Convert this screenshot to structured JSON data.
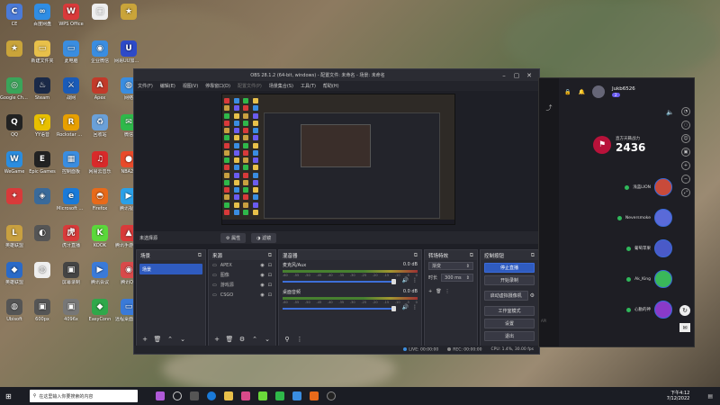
{
  "desktop": {
    "icons": [
      {
        "label": "CE",
        "color": "#4a7ad8",
        "glyph": "C"
      },
      {
        "label": "百度网盘",
        "color": "#2f8de4",
        "glyph": "∞"
      },
      {
        "label": "WPS Office",
        "color": "#d93a3a",
        "glyph": "W"
      },
      {
        "label": "",
        "color": "#eee",
        "glyph": "▢"
      },
      {
        "label": "",
        "color": "#c9a43a",
        "glyph": "★"
      },
      {
        "label": "",
        "color": "#c9a43a",
        "glyph": "★"
      },
      {
        "label": "新建文件夹",
        "color": "#e8c04a",
        "glyph": "▭"
      },
      {
        "label": "此电脑",
        "color": "#3a8de0",
        "glyph": "▭"
      },
      {
        "label": "企业微信",
        "color": "#3a8de0",
        "glyph": "◉"
      },
      {
        "label": "网易UU加速器",
        "color": "#2d4ac8",
        "glyph": "U"
      },
      {
        "label": "Google Chrome",
        "color": "#3aa55a",
        "glyph": "◎"
      },
      {
        "label": "Steam",
        "color": "#1b2a48",
        "glyph": "♨"
      },
      {
        "label": "战网",
        "color": "#1a5bb8",
        "glyph": "⚔"
      },
      {
        "label": "Apex",
        "color": "#c23a2a",
        "glyph": "A"
      },
      {
        "label": "网络",
        "color": "#3a8de0",
        "glyph": "◍"
      },
      {
        "label": "QQ",
        "color": "#222",
        "glyph": "Q"
      },
      {
        "label": "YY语音",
        "color": "#e8c000",
        "glyph": "Y"
      },
      {
        "label": "Rockstar Games",
        "color": "#e8a000",
        "glyph": "R"
      },
      {
        "label": "回收站",
        "color": "#6aa0d8",
        "glyph": "♻"
      },
      {
        "label": "微信",
        "color": "#2fb84a",
        "glyph": "✉"
      },
      {
        "label": "WeGame",
        "color": "#2a8de0",
        "glyph": "W"
      },
      {
        "label": "Epic Games",
        "color": "#222",
        "glyph": "E"
      },
      {
        "label": "控制面板",
        "color": "#3a8de0",
        "glyph": "▦"
      },
      {
        "label": "网易云音乐",
        "color": "#d82a2a",
        "glyph": "♫"
      },
      {
        "label": "NBA2K",
        "color": "#e84a2a",
        "glyph": "●"
      },
      {
        "label": "",
        "color": "#d83a3a",
        "glyph": "✦"
      },
      {
        "label": "",
        "color": "#3a6a9a",
        "glyph": "◈"
      },
      {
        "label": "Microsoft Edge",
        "color": "#1a7ad8",
        "glyph": "e"
      },
      {
        "label": "Firefox",
        "color": "#e86a1a",
        "glyph": "◓"
      },
      {
        "label": "腾讯视频",
        "color": "#2aa0e8",
        "glyph": "▶"
      },
      {
        "label": "英雄联盟",
        "color": "#c8a040",
        "glyph": "L"
      },
      {
        "label": "",
        "color": "#555",
        "glyph": "◐"
      },
      {
        "label": "虎牙直播",
        "color": "#d83a3a",
        "glyph": "虎"
      },
      {
        "label": "KOOK",
        "color": "#5ad83a",
        "glyph": "K"
      },
      {
        "label": "腾讯手游助手",
        "color": "#d83a3a",
        "glyph": "▲"
      },
      {
        "label": "英雄联盟",
        "color": "#2a6ac8",
        "glyph": "◆"
      },
      {
        "label": "",
        "color": "#eee",
        "glyph": "◍"
      },
      {
        "label": "屏幕录制",
        "color": "#444",
        "glyph": "▣"
      },
      {
        "label": "腾讯会议",
        "color": "#3a7ad8",
        "glyph": "▶"
      },
      {
        "label": "腾讯QQ",
        "color": "#d84a4a",
        "glyph": "◉"
      },
      {
        "label": "Ubisoft",
        "color": "#555",
        "glyph": "◍"
      },
      {
        "label": "600px",
        "color": "#555",
        "glyph": "▣"
      },
      {
        "label": "4096x",
        "color": "#777",
        "glyph": "▣"
      },
      {
        "label": "EasyConn",
        "color": "#2fa84a",
        "glyph": "◆"
      },
      {
        "label": "远程桌面连接",
        "color": "#3a7ad8",
        "glyph": "▭"
      }
    ]
  },
  "obs": {
    "title": "OBS 28.1.2 (64-bit, windows) - 配置文件: 未命名 - 场景: 未命名",
    "menu": [
      "文件(F)",
      "编辑(E)",
      "视图(V)",
      "停靠窗口(D)",
      "配置文件(P)",
      "场景集合(S)",
      "工具(T)",
      "帮助(H)"
    ],
    "source_bar": {
      "label": "未选择源",
      "properties": "属性",
      "filters": "滤镜"
    },
    "scenes": {
      "title": "场景",
      "items": [
        "场景"
      ]
    },
    "sources": {
      "title": "来源",
      "items": [
        "APEX",
        "图像",
        "游戏源",
        "CSGO"
      ]
    },
    "mixer": {
      "title": "混音器",
      "channels": [
        {
          "name": "麦克风/Aux",
          "db": "0.0 dB"
        },
        {
          "name": "桌面音频",
          "db": "0.0 dB"
        }
      ],
      "scale": [
        "-60",
        "-55",
        "-50",
        "-45",
        "-40",
        "-35",
        "-30",
        "-25",
        "-20",
        "-15",
        "-10",
        "-5",
        "0"
      ]
    },
    "transitions": {
      "title": "转场特效",
      "type": "渐变",
      "duration_label": "时长",
      "duration": "300 ms"
    },
    "controls": {
      "title": "控制按钮",
      "buttons": [
        "停止直播",
        "开始录制",
        "启动虚拟摄像机",
        "工作室模式",
        "设置",
        "退出"
      ]
    },
    "status": {
      "live": "LIVE: 00:00:00",
      "rec": "REC: 00:00:00",
      "cpu": "CPU: 1.4%, 30.00 fps"
    }
  },
  "chat": {
    "username": "Jukb6526",
    "badge": "2",
    "score_label": "直方天籁战力",
    "score": "2436",
    "ranks": [
      {
        "name": "浅蓝LION",
        "color": "#c84a3a"
      },
      {
        "name": "Neversmoke",
        "color": "#5a6ad8"
      },
      {
        "name": "葡萄苹果",
        "color": "#4a5ac8"
      },
      {
        "name": "Ak_King",
        "color": "#3ab85a"
      },
      {
        "name": "心動的神",
        "color": "#8a3ac8"
      }
    ]
  },
  "taskbar": {
    "search_placeholder": "在这里输入你要搜索的内容",
    "time": "下午4:12",
    "date": "7/12/2022"
  }
}
